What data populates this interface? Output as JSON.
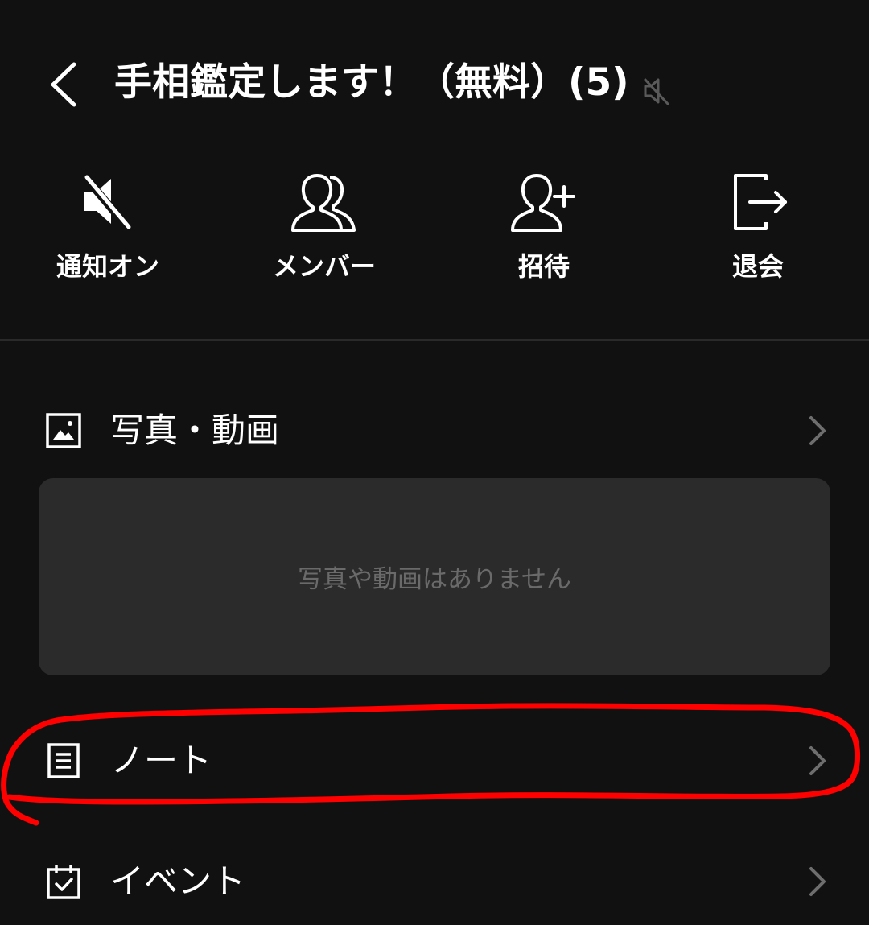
{
  "header": {
    "title": "手相鑑定します！（無料）",
    "member_count": "(5)",
    "back_icon": "chevron-left-icon",
    "muted_indicator_icon": "muted-speaker-icon"
  },
  "actions": [
    {
      "label": "通知オン",
      "icon": "speaker-muted-icon"
    },
    {
      "label": "メンバー",
      "icon": "members-icon"
    },
    {
      "label": "招待",
      "icon": "add-user-icon"
    },
    {
      "label": "退会",
      "icon": "exit-icon"
    }
  ],
  "sections": {
    "photos": {
      "label": "写真・動画",
      "icon": "image-icon",
      "empty_text": "写真や動画はありません"
    },
    "notes": {
      "label": "ノート",
      "icon": "note-icon"
    },
    "events": {
      "label": "イベント",
      "icon": "calendar-check-icon"
    }
  },
  "colors": {
    "background": "#111111",
    "panel": "#2b2b2b",
    "annotation": "#ff0000",
    "muted_text": "#6a6a6a"
  }
}
